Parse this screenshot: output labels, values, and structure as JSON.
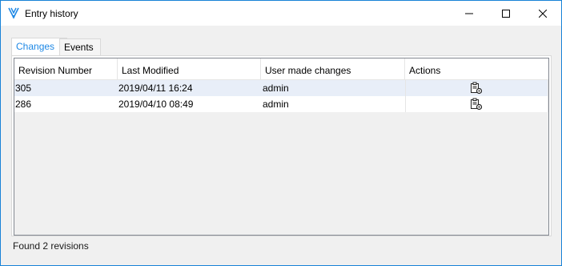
{
  "window": {
    "title": "Entry history"
  },
  "tabs": [
    {
      "label": "Changes",
      "active": true
    },
    {
      "label": "Events",
      "active": false
    }
  ],
  "table": {
    "columns": [
      "Revision Number",
      "Last Modified",
      "User made changes",
      "Actions"
    ],
    "rows": [
      {
        "revision": "305",
        "modified": "2019/04/11 16:24",
        "user": "admin",
        "action_icon": "revision-details-icon"
      },
      {
        "revision": "286",
        "modified": "2019/04/10 08:49",
        "user": "admin",
        "action_icon": "revision-details-icon"
      }
    ]
  },
  "status": {
    "text": "Found 2 revisions"
  },
  "colors": {
    "accent": "#1e88e5",
    "border": "#1883d7",
    "selected_row": "#e8eef8"
  }
}
